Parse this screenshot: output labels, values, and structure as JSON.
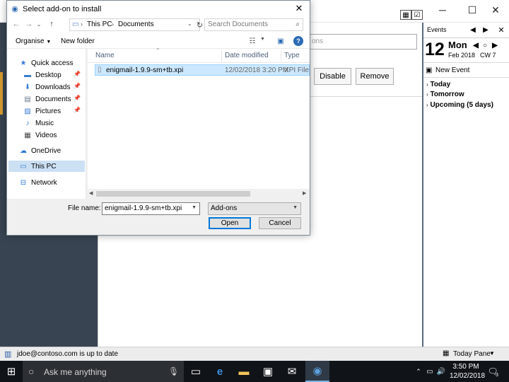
{
  "thunderbird": {
    "addon_search_placeholder": "ons",
    "disable_label": "Disable",
    "remove_label": "Remove",
    "today_pane": {
      "events_label": "Events",
      "day": "12",
      "weekday": "Mon",
      "month_year": "Feb 2018",
      "calendar_week": "CW 7",
      "new_event_label": "New Event",
      "agenda": [
        "Today",
        "Tomorrow",
        "Upcoming (5 days)"
      ]
    },
    "status_text": "jdoe@contoso.com is up to date",
    "today_pane_toggle": "Today Pane"
  },
  "dialog": {
    "title": "Select add-on to install",
    "breadcrumb": [
      "This PC",
      "Documents"
    ],
    "search_placeholder": "Search Documents",
    "organise_label": "Organise",
    "new_folder_label": "New folder",
    "nav_items": [
      {
        "label": "Quick access",
        "icon": "star-icon",
        "pinned": false
      },
      {
        "label": "Desktop",
        "icon": "desktop-folder-icon",
        "pinned": true
      },
      {
        "label": "Downloads",
        "icon": "download-icon",
        "pinned": true
      },
      {
        "label": "Documents",
        "icon": "documents-icon",
        "pinned": true
      },
      {
        "label": "Pictures",
        "icon": "pictures-icon",
        "pinned": true
      },
      {
        "label": "Music",
        "icon": "music-icon",
        "pinned": false
      },
      {
        "label": "Videos",
        "icon": "videos-icon",
        "pinned": false
      },
      {
        "label": "OneDrive",
        "icon": "cloud-icon",
        "pinned": false
      },
      {
        "label": "This PC",
        "icon": "computer-icon",
        "pinned": false,
        "selected": true
      },
      {
        "label": "Network",
        "icon": "network-icon",
        "pinned": false
      }
    ],
    "columns": [
      "Name",
      "Date modified",
      "Type"
    ],
    "files": [
      {
        "name": "enigmail-1.9.9-sm+tb.xpi",
        "date": "12/02/2018 3:20 PM",
        "type": "XPI File"
      }
    ],
    "file_name_label": "File name:",
    "file_name_value": "enigmail-1.9.9-sm+tb.xpi",
    "file_type_value": "Add-ons",
    "open_label": "Open",
    "cancel_label": "Cancel"
  },
  "taskbar": {
    "search_placeholder": "Ask me anything",
    "time": "3:50 PM",
    "date": "12/02/2018",
    "notification_count": "3"
  }
}
